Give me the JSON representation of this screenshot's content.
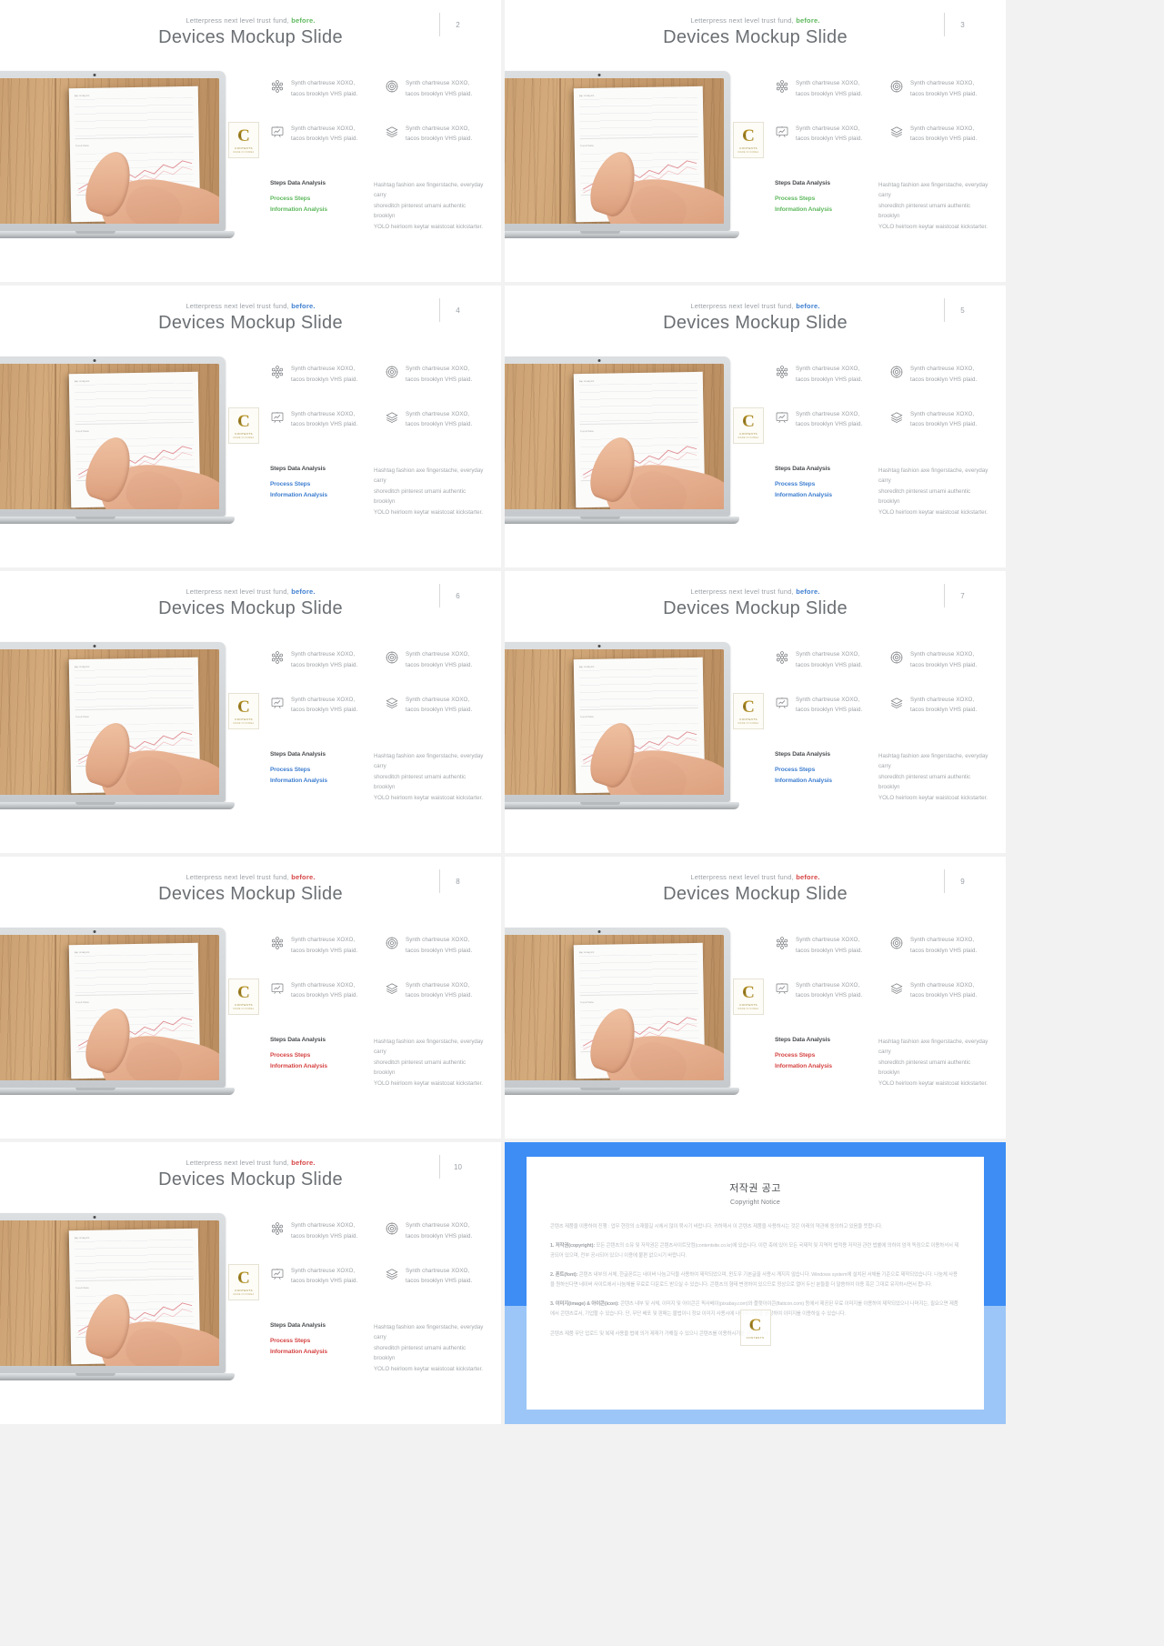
{
  "deck": {
    "kicker_prefix": "Letterpress next level trust fund,",
    "kicker_accent": "before.",
    "title": "Devices Mockup Slide",
    "feature_text_line1": "Synth chartreuse XOXO,",
    "feature_text_line2": "tacos brooklyn VHS plaid.",
    "analysis_heading": "Steps Data Analysis",
    "analysis_accent_line1": "Process Steps",
    "analysis_accent_line2": "Information Analysis",
    "paragraph_line1": "Hashtag fashion axe fingerstache, everyday carry",
    "paragraph_line2": "shoreditch pinterest umami authentic brooklyn",
    "paragraph_line3": "YOLO heirloom keytar waistcoat kickstarter.",
    "logo": {
      "mark": "C",
      "name": "CONTENTS",
      "tagline": "MADE IN KOREA"
    },
    "icons": [
      "atom-icon",
      "target-icon",
      "presentation-chart-icon",
      "layers-icon"
    ]
  },
  "slides": [
    {
      "page": "2",
      "accent": "#5fb85f"
    },
    {
      "page": "3",
      "accent": "#5fb85f"
    },
    {
      "page": "4",
      "accent": "#3f7fd0"
    },
    {
      "page": "5",
      "accent": "#3f7fd0"
    },
    {
      "page": "6",
      "accent": "#3f7fd0"
    },
    {
      "page": "7",
      "accent": "#3f7fd0"
    },
    {
      "page": "8",
      "accent": "#d64545"
    },
    {
      "page": "9",
      "accent": "#d64545"
    },
    {
      "page": "10",
      "accent": "#d64545"
    }
  ],
  "copyright": {
    "title": "저작권 공고",
    "subtitle": "Copyright Notice",
    "intro": "콘텐츠 제품을 이용하여 진행 : 업무 현장의 소재물길 시에서 많이 묶시기 바랍니다. 귀하께서 이 콘텐츠 제품을 사용하시는 것은 아래의 약관에 동의하고 있음을 뜻합니다.",
    "p1_label": "1. 저작권(copyright):",
    "p1": "모든 콘텐츠의 소유 및 저작권은 콘텐츠사이트닷컴(contentsite.co.kr)에 있습니다. 이런 축에 있어 모든 국제적 및 지역적 법적용 저작권 관련 법률에 의하여 엄격 독점으로 이용하셔서 제공되어 있으며, 전부 공시되어 있으니 이용에 불편 없으시기 바랍니다.",
    "p2_label": "2. 폰트(font):",
    "p2": "콘텐츠 내부의 서체, 한글폰트는 네이버 나눔고딕을 사용하여 제작되었으며, 윈도우 기본글꼴 사용시 깨지지 않습니다. Windows system에 설치된 서체를 기준으로 제작되었습니다. 나눔체 사용을 원하신다면 네이버 사이트에서 나눔체를 무료로 다운로드 받으실 수 있습니다. 콘텐츠의 형태 변경하여 있으므로 정상으로 열어 두신 분들을 더 말씀하여 이용 혹은 그대로 유지하시면서 합니다.",
    "p3_label": "3. 이미지(image) & 아이콘(icon):",
    "p3": "콘텐츠 내부 및 서체, 이미지 및 아이콘은 픽사베이(pixabay.com)와 플랫아이콘(flaticon.com) 등에서 제공된 무료 이미지를 이용하여 제작되었으나 나머지는, 필요으면 제품에서 콘텐츠로서, 기업할 수 있습니다. 단, 무단 배포 및 판매는 불법이니 정보 이미지 사용시에 나머지 이용을 권장하여 이미지를 이용하실 수 있습니다.",
    "footer": "콘텐츠 제품 무단 업로드 및 복제 사용을 법에 의거 제재가 가해질 수 있으니 콘텐츠를 이용하시기를 권장합니다."
  }
}
